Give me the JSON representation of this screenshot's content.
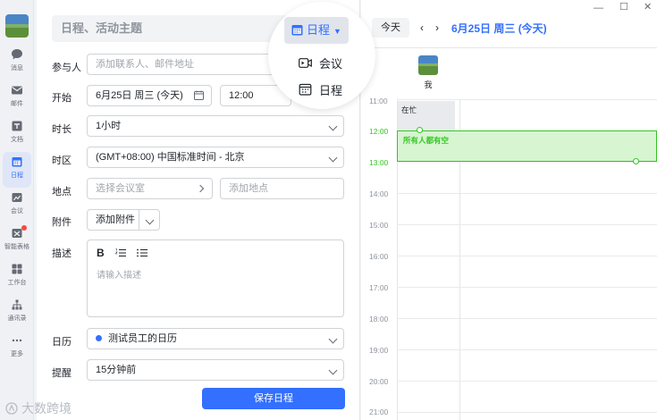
{
  "nav": {
    "items": [
      {
        "label": "消息",
        "icon": "chat-bubble-icon"
      },
      {
        "label": "邮件",
        "icon": "mail-icon"
      },
      {
        "label": "文档",
        "icon": "document-icon"
      },
      {
        "label": "日程",
        "icon": "calendar-icon"
      },
      {
        "label": "会议",
        "icon": "meeting-icon"
      },
      {
        "label": "智能表格",
        "icon": "smart-table-icon"
      },
      {
        "label": "工作台",
        "icon": "workbench-icon"
      },
      {
        "label": "通讯录",
        "icon": "contacts-icon"
      },
      {
        "label": "更多",
        "icon": "more-icon"
      }
    ],
    "active_index": 3
  },
  "form": {
    "title_placeholder": "日程、活动主题",
    "type_selected": "日程",
    "type_options": [
      "会议",
      "日程"
    ],
    "labels": {
      "attendees": "参与人",
      "start": "开始",
      "duration": "时长",
      "timezone": "时区",
      "location": "地点",
      "attachment": "附件",
      "description": "描述",
      "calendar": "日历",
      "reminder": "提醒"
    },
    "attendees_placeholder": "添加联系人、邮件地址",
    "start_date": "6月25日 周三 (今天)",
    "start_time": "12:00",
    "duration_value": "1小时",
    "timezone_value": "(GMT+08:00) 中国标准时间 - 北京",
    "room_placeholder": "选择会议室",
    "location_placeholder": "添加地点",
    "attachment_button": "添加附件",
    "desc_bold": "B",
    "desc_placeholder": "请输入描述",
    "calendar_value": "测试员工的日历",
    "reminder_value": "15分钟前",
    "save_button": "保存日程"
  },
  "calendar": {
    "today_button": "今天",
    "date_title": "6月25日 周三 (今天)",
    "person_name": "我",
    "hours": [
      "11:00",
      "12:00",
      "13:00",
      "14:00",
      "15:00",
      "16:00",
      "17:00",
      "18:00",
      "19:00",
      "20:00",
      "21:00"
    ],
    "busy_label": "在忙",
    "free_label": "所有人都有空"
  },
  "watermark": "大数跨境",
  "colors": {
    "accent": "#3370ff",
    "free_green": "#34c724",
    "badge_red": "#f54a45"
  }
}
